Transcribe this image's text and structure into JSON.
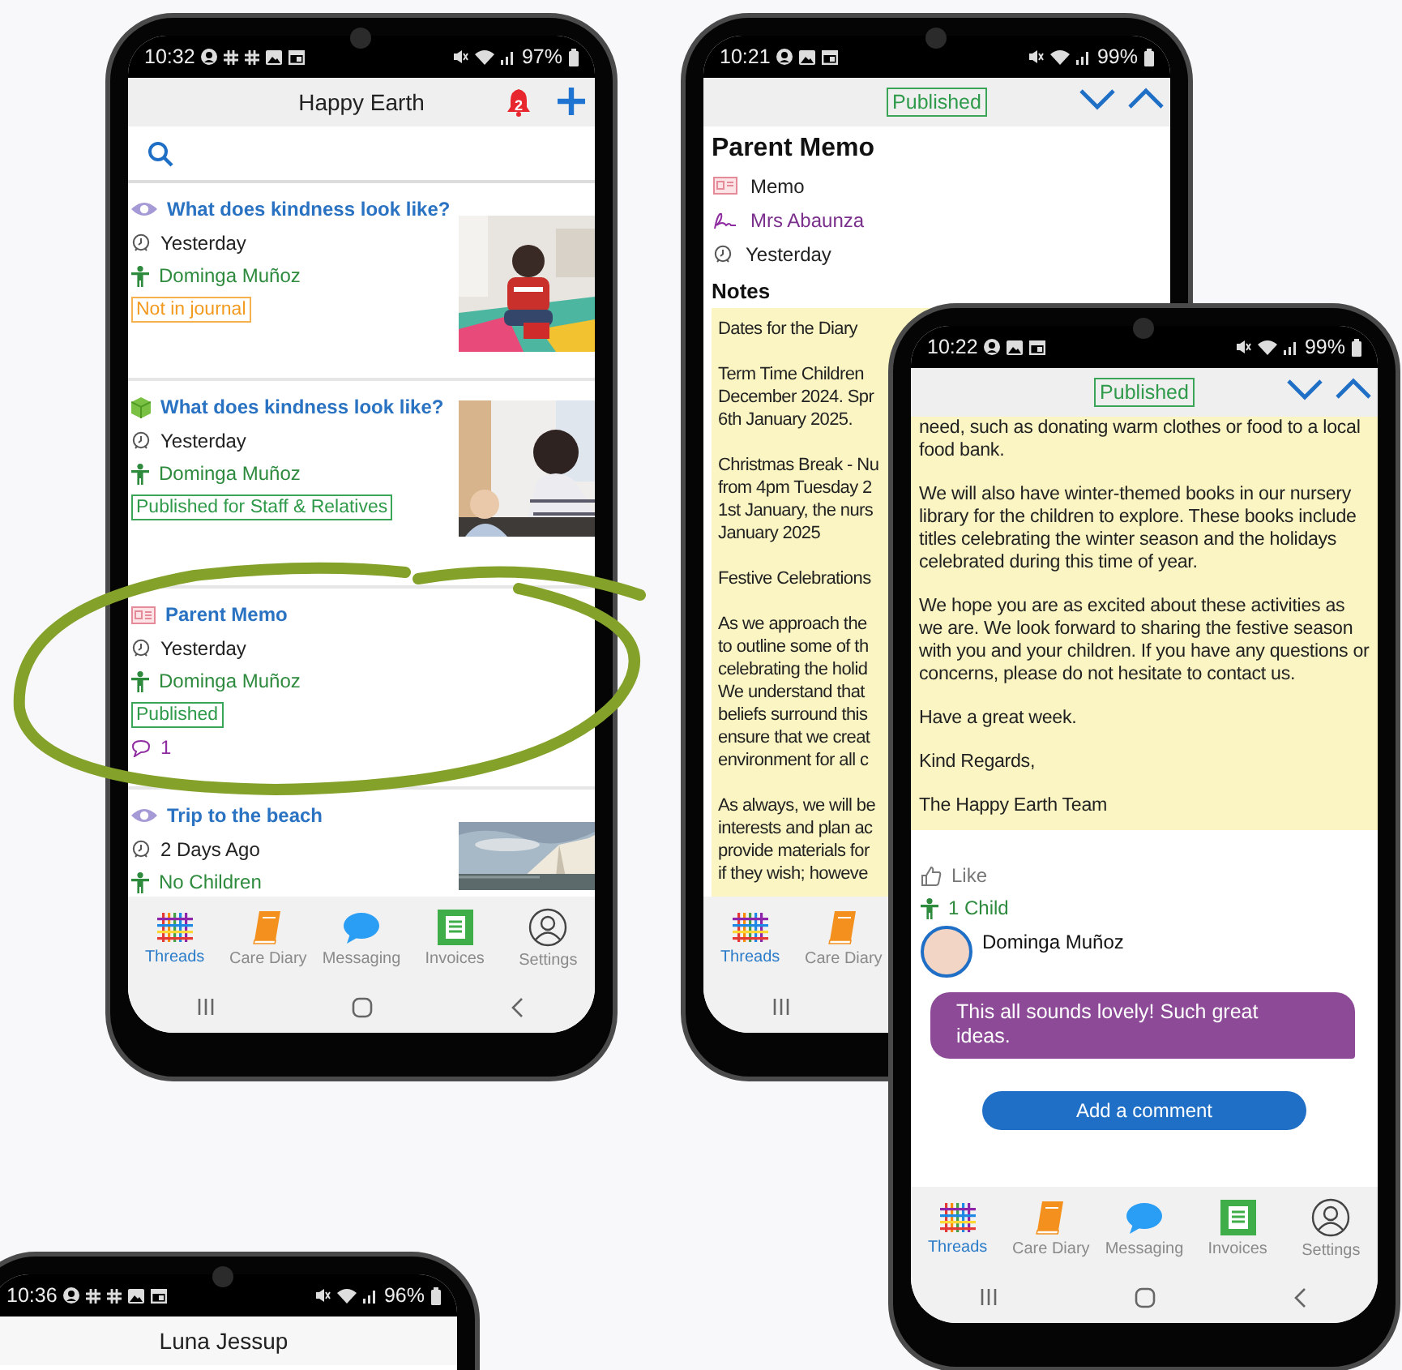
{
  "thread_list_phone": {
    "status": {
      "time": "10:32",
      "battery": "97%"
    },
    "header": {
      "title": "Happy Earth",
      "notification_count": "2"
    },
    "threads": [
      {
        "kind": "observation",
        "title": "What does kindness look like?",
        "time": "Yesterday",
        "children": "Dominga Muñoz",
        "tag": {
          "label": "Not in journal",
          "kind": "warning"
        }
      },
      {
        "kind": "activity",
        "title": "What does kindness look like?",
        "time": "Yesterday",
        "children": "Dominga Muñoz",
        "tag": {
          "label": "Published for Staff & Relatives",
          "kind": "published"
        }
      },
      {
        "kind": "memo",
        "title": "Parent Memo",
        "time": "Yesterday",
        "children": "Dominga Muñoz",
        "tag": {
          "label": "Published",
          "kind": "published"
        },
        "comments": "1"
      },
      {
        "kind": "observation",
        "title": "Trip to the beach",
        "time": "2 Days Ago",
        "children": "No Children"
      }
    ],
    "tabs": [
      {
        "label": "Threads",
        "selected": true
      },
      {
        "label": "Care Diary",
        "selected": false
      },
      {
        "label": "Messaging",
        "selected": false
      },
      {
        "label": "Invoices",
        "selected": false
      },
      {
        "label": "Settings",
        "selected": false
      }
    ]
  },
  "memo_phone": {
    "status": {
      "time": "10:21",
      "battery": "99%"
    },
    "status_badge": "Published",
    "title": "Parent Memo",
    "details": [
      {
        "kind": "type",
        "text": "Memo"
      },
      {
        "kind": "author",
        "text": "Mrs Abaunza"
      },
      {
        "kind": "time",
        "text": "Yesterday"
      }
    ],
    "notes_heading": "Notes",
    "notes": [
      [
        "Dates for the Diary"
      ],
      [
        "Term Time Children",
        "December 2024. Spr",
        "6th January 2025."
      ],
      [
        "Christmas Break - Nu",
        "from 4pm Tuesday 2",
        "1st January, the nurs",
        "January 2025"
      ],
      [
        "Festive Celebrations"
      ],
      [
        "As we approach the",
        "to outline some of th",
        "celebrating the holid",
        "We understand that",
        "beliefs surround this",
        "ensure that we creat",
        "environment for all c"
      ],
      [
        "As always, we will be",
        "interests and plan ac",
        "provide materials for",
        "if they wish; howeve"
      ]
    ],
    "tabs": [
      {
        "label": "Threads",
        "selected": true
      },
      {
        "label": "Care Diary",
        "selected": false
      }
    ]
  },
  "memo_detail_phone": {
    "status": {
      "time": "10:22",
      "battery": "99%"
    },
    "status_badge": "Published",
    "notes": [
      "need, such as donating warm clothes or food to a local food bank.",
      "We will also have winter-themed books in our nursery library for the children to explore. These books include titles celebrating the winter season and the holidays celebrated during this time of year.",
      "We hope you are as excited about these activities as we are. We look forward to sharing the festive season with you and your children. If you have any questions or concerns, please do not hesitate to contact us.",
      "Have a great week.",
      "Kind Regards,",
      "The Happy Earth Team"
    ],
    "like": "Like",
    "children": "1 Child",
    "comment": {
      "author": "Dominga Muñoz",
      "text": "This all sounds lovely! Such great ideas."
    },
    "add_comment": "Add a comment",
    "tabs": [
      {
        "label": "Threads",
        "selected": true
      },
      {
        "label": "Care Diary",
        "selected": false
      },
      {
        "label": "Messaging",
        "selected": false
      },
      {
        "label": "Invoices",
        "selected": false
      },
      {
        "label": "Settings",
        "selected": false
      }
    ]
  },
  "profile_phone": {
    "status": {
      "time": "10:36",
      "battery": "96%"
    },
    "header": {
      "title": "Luna Jessup"
    }
  }
}
